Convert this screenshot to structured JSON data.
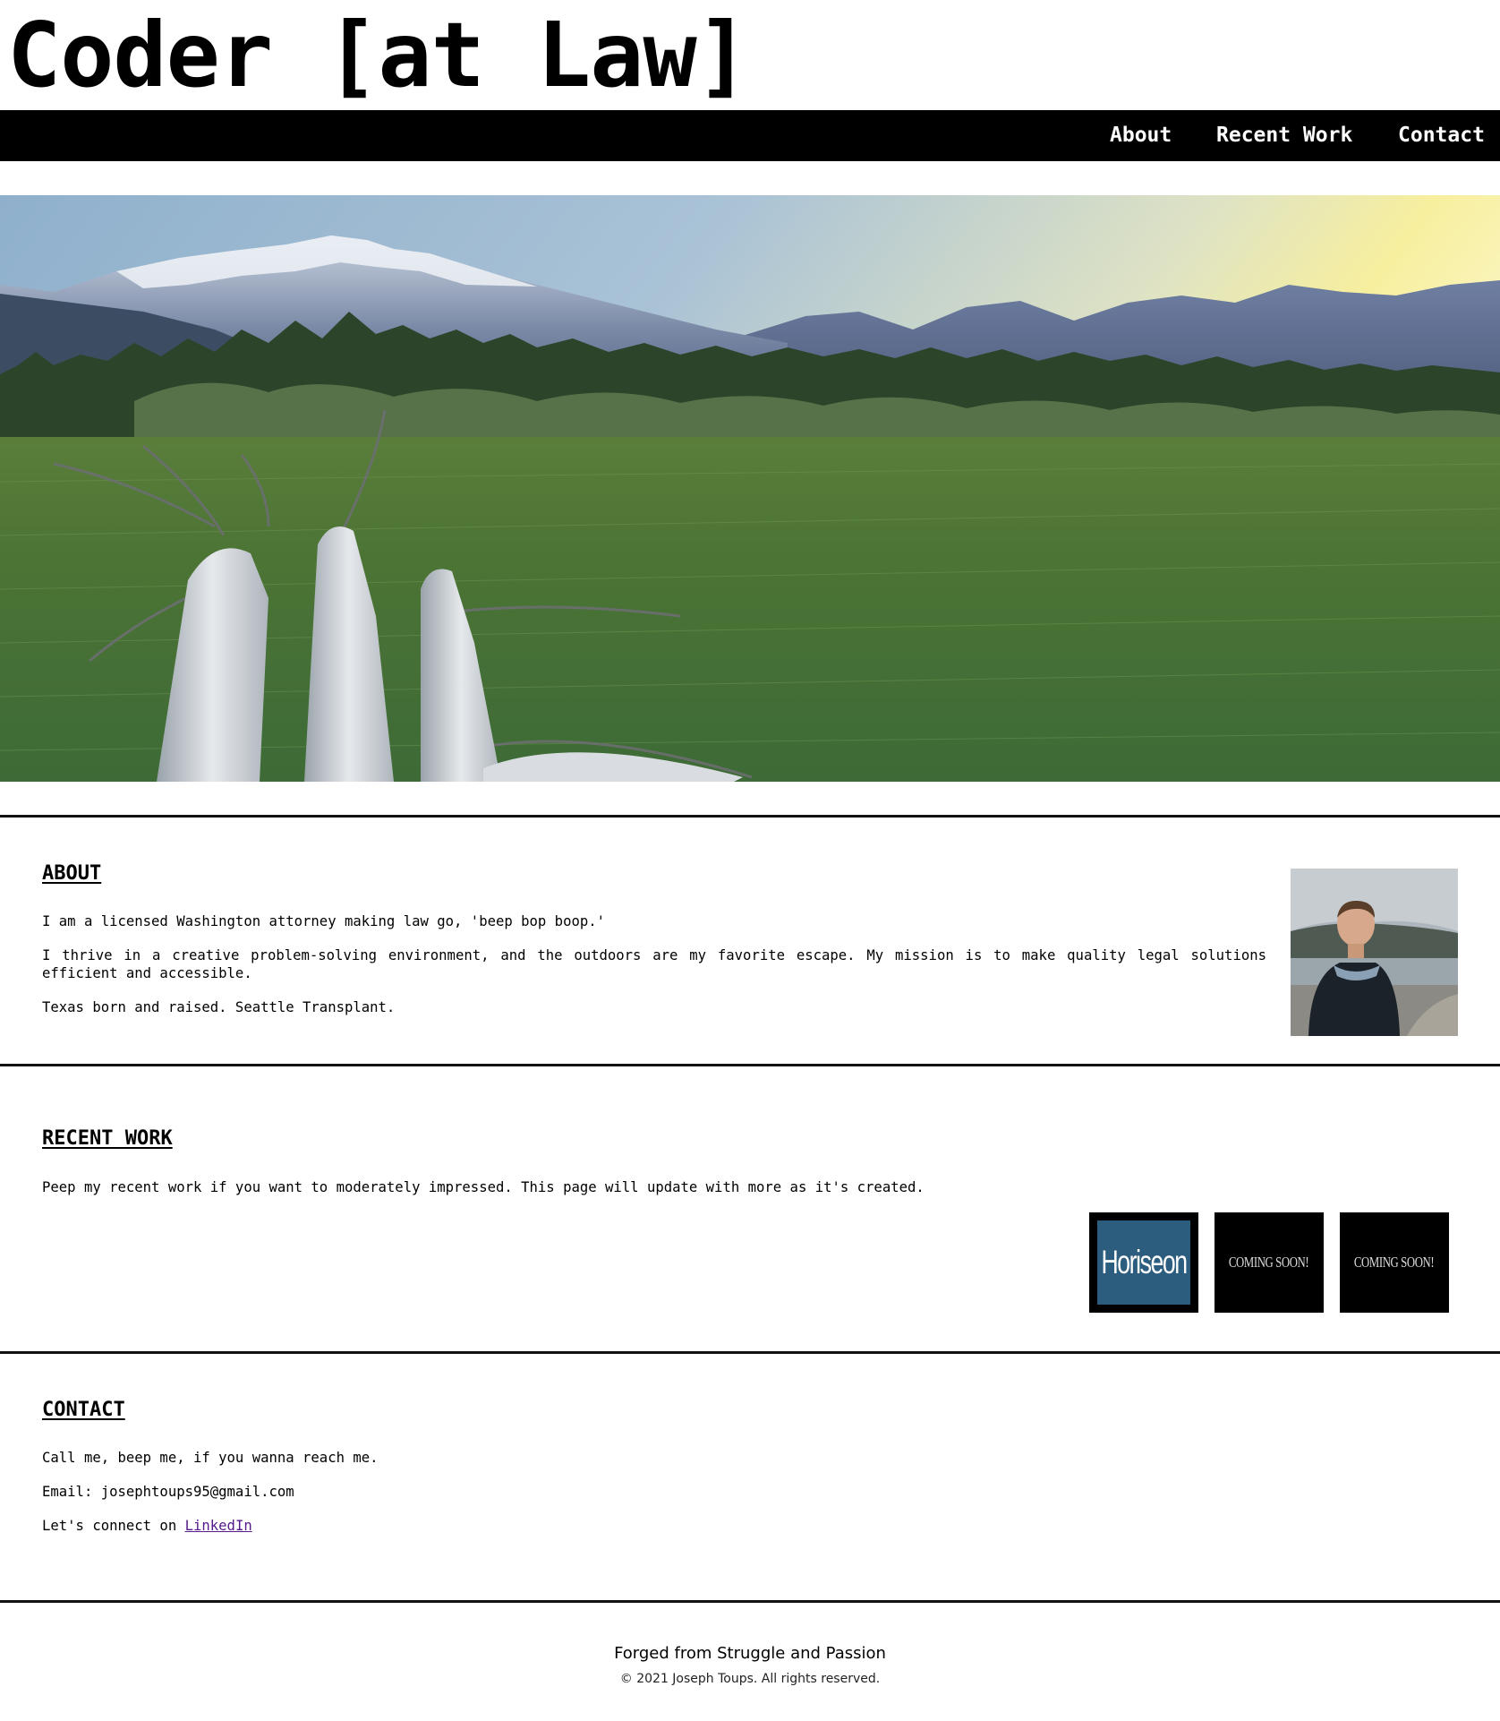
{
  "header": {
    "title": "Coder [at Law]"
  },
  "nav": {
    "items": [
      {
        "label": "About"
      },
      {
        "label": "Recent Work"
      },
      {
        "label": "Contact"
      }
    ]
  },
  "about": {
    "heading": "ABOUT",
    "paragraphs": [
      "I am a licensed Washington attorney making law go, 'beep bop boop.'",
      "I thrive in a creative problem-solving environment, and the outdoors are my favorite escape. My mission is to make quality legal solutions efficient and accessible.",
      "Texas born and raised. Seattle Transplant."
    ]
  },
  "recent_work": {
    "heading": "RECENT WORK",
    "intro": "Peep my recent work if you want to moderately impressed. This page will update with more as it's created.",
    "projects": [
      {
        "label": "Horiseon",
        "color": "#2c5d7e"
      },
      {
        "label": "COMING SOON!"
      },
      {
        "label": "COMING SOON!"
      }
    ]
  },
  "contact": {
    "heading": "CONTACT",
    "line1": "Call me, beep me, if you wanna reach me.",
    "email_line": "Email: josephtoups95@gmail.com",
    "linkedin_prefix": "Let's connect on ",
    "linkedin_label": "LinkedIn"
  },
  "footer": {
    "title": "Forged from Struggle and Passion",
    "copyright": "© 2021 Joseph Toups. All rights reserved."
  },
  "colors": {
    "nav_bg": "#000000",
    "nav_text": "#ffffff",
    "link_visited": "#551a8b",
    "horiseon_blue": "#2c5d7e"
  }
}
